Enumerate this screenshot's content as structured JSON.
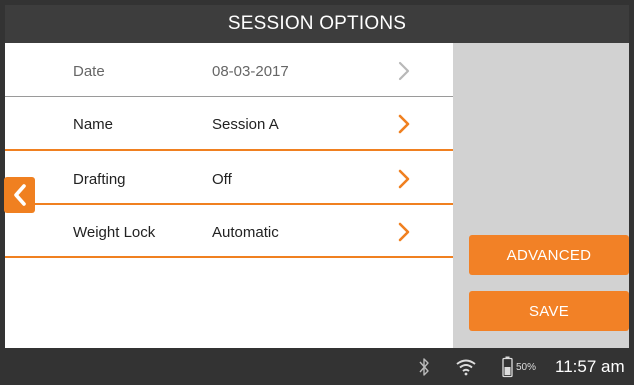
{
  "header": {
    "title": "SESSION OPTIONS"
  },
  "options": [
    {
      "label": "Date",
      "value": "08-03-2017",
      "enabled": false
    },
    {
      "label": "Name",
      "value": "Session A",
      "enabled": true
    },
    {
      "label": "Drafting",
      "value": "Off",
      "enabled": true
    },
    {
      "label": "Weight Lock",
      "value": "Automatic",
      "enabled": true
    }
  ],
  "buttons": {
    "advanced": "ADVANCED",
    "save": "SAVE"
  },
  "status": {
    "battery": "50%",
    "time": "11:57 am"
  },
  "colors": {
    "accent": "#f08020",
    "header_bg": "#3d3d3d",
    "side_panel": "#d2d2d2",
    "disabled_chevron": "#b8b8b8"
  },
  "icons": [
    "back-arrow-icon",
    "chevron-right-icon",
    "bluetooth-icon",
    "wifi-icon",
    "battery-icon"
  ]
}
